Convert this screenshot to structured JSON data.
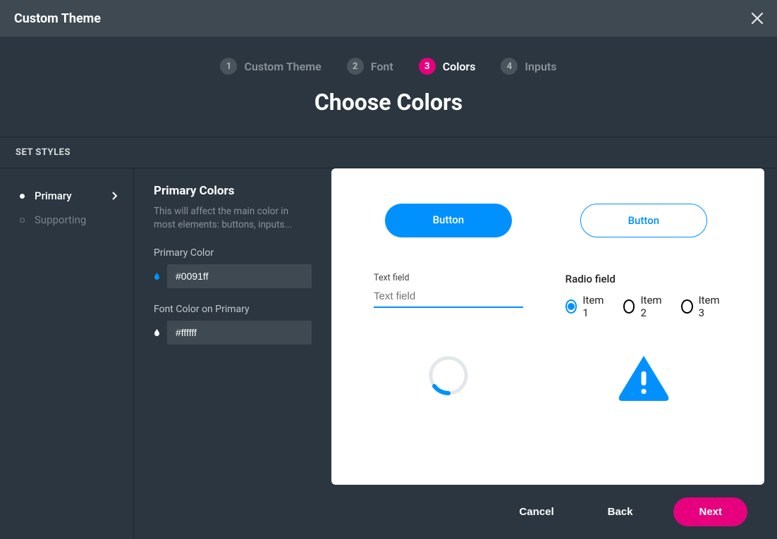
{
  "titlebar": {
    "title": "Custom Theme"
  },
  "stepper": {
    "steps": [
      {
        "num": "1",
        "label": "Custom Theme"
      },
      {
        "num": "2",
        "label": "Font"
      },
      {
        "num": "3",
        "label": "Colors"
      },
      {
        "num": "4",
        "label": "Inputs"
      }
    ],
    "active_index": 2
  },
  "page_title": "Choose Colors",
  "section_header": "SET STYLES",
  "sidebar": {
    "items": [
      {
        "label": "Primary",
        "active": true
      },
      {
        "label": "Supporting",
        "active": false
      }
    ]
  },
  "config": {
    "heading": "Primary Colors",
    "description": "This will affect the main color in most elements: buttons, inputs...",
    "primary_color": {
      "label": "Primary Color",
      "value": "#0091ff"
    },
    "font_color": {
      "label": "Font Color on Primary",
      "value": "#ffffff"
    }
  },
  "preview": {
    "button_solid": "Button",
    "button_outline": "Button",
    "text_field": {
      "label": "Text field",
      "placeholder": "Text field"
    },
    "radio": {
      "label": "Radio field",
      "options": [
        "Item 1",
        "Item 2",
        "Item 3"
      ],
      "selected_index": 0
    }
  },
  "footer": {
    "cancel": "Cancel",
    "back": "Back",
    "next": "Next"
  },
  "colors": {
    "accent_pink": "#e6007e",
    "accent_blue": "#0091ff"
  }
}
